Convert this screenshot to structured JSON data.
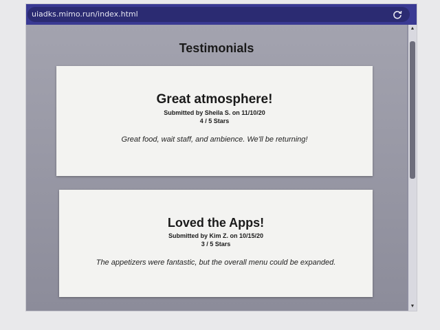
{
  "browser": {
    "url": "uiadks.mimo.run/index.html",
    "reload_icon": "reload-icon"
  },
  "page": {
    "title": "Testimonials"
  },
  "testimonials": [
    {
      "title": "Great atmosphere!",
      "meta": "Submitted by Sheila S. on 11/10/20",
      "stars": "4 / 5 Stars",
      "body": "Great food, wait staff, and ambience. We'll be returning!"
    },
    {
      "title": "Loved the Apps!",
      "meta": "Submitted by Kim Z. on 10/15/20",
      "stars": "3 / 5 Stars",
      "body": "The appetizers were fantastic, but the overall menu could be expanded."
    }
  ],
  "scrollbar": {
    "up_glyph": "▲",
    "down_glyph": "▼"
  }
}
